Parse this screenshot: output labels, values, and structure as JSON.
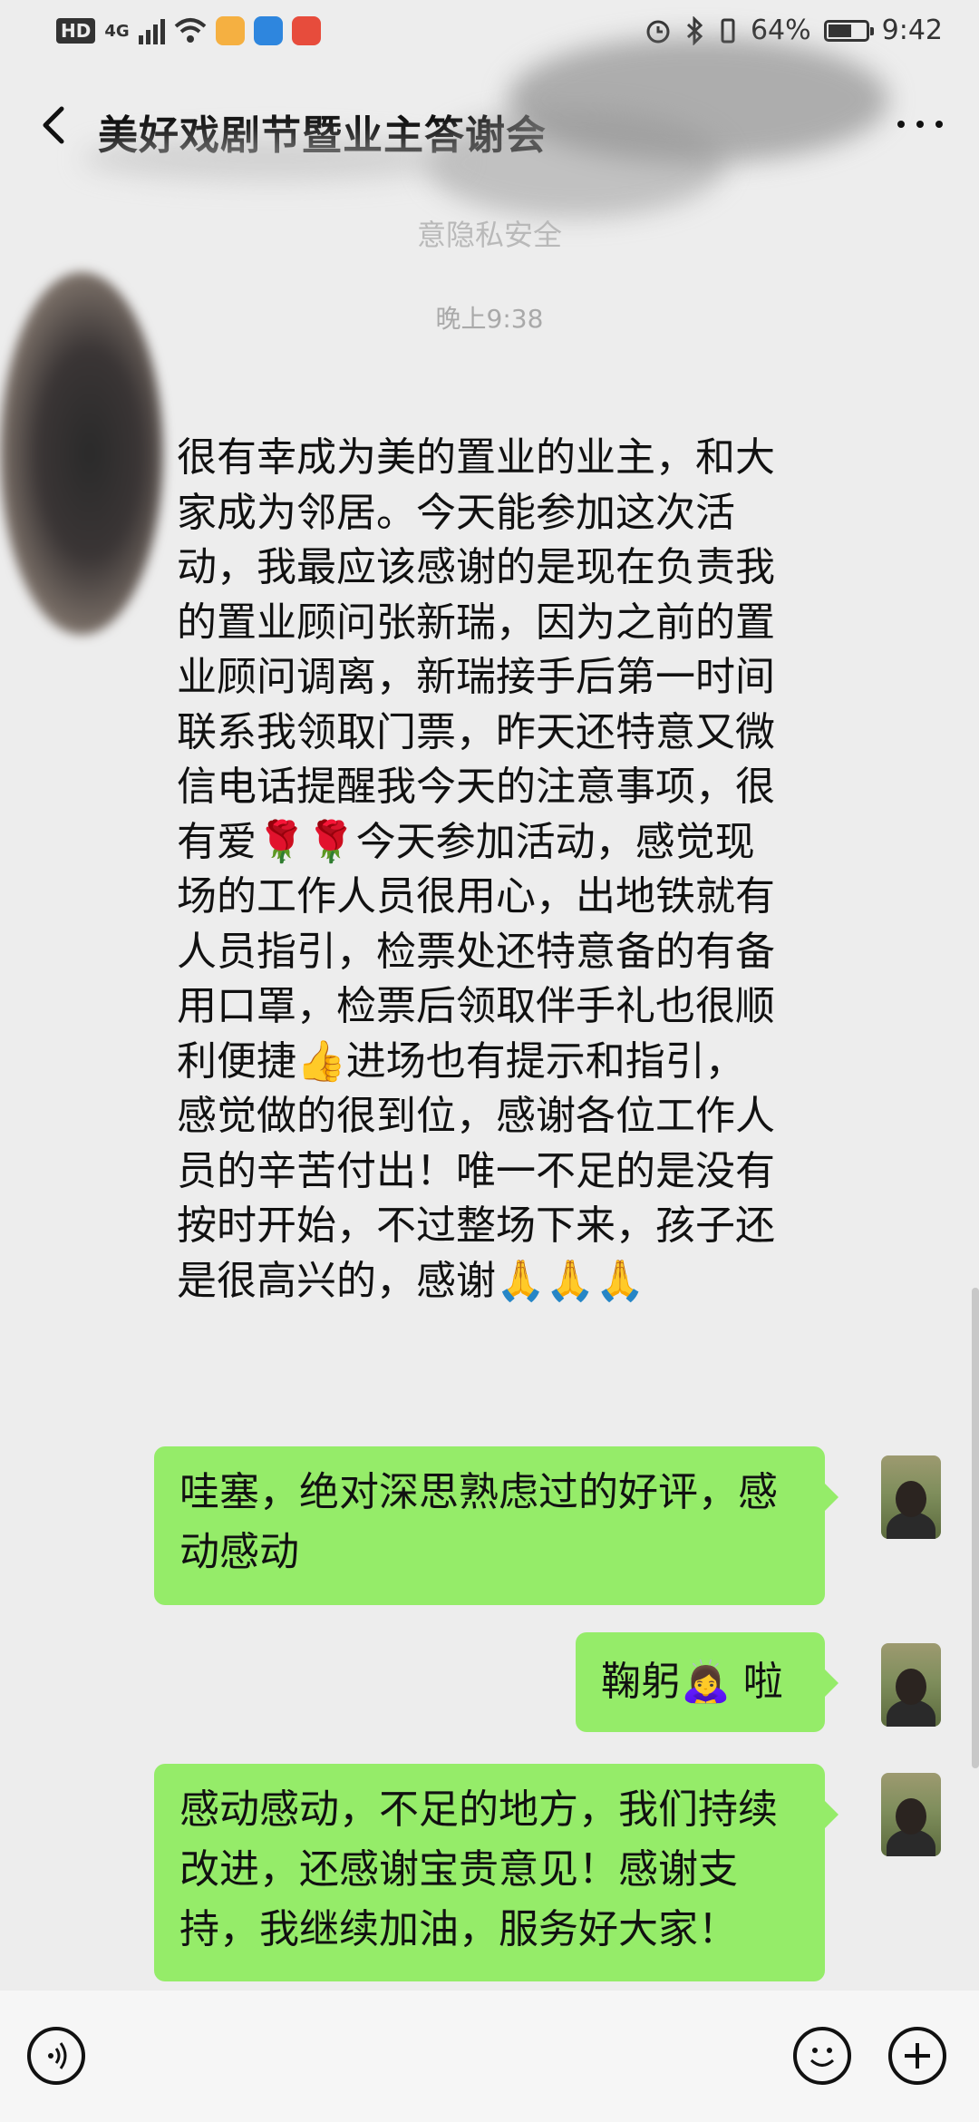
{
  "status_bar": {
    "hd": "HD",
    "network": "4G",
    "battery": "64%",
    "time": "9:42",
    "battery_level": 0.64
  },
  "header": {
    "title": "美好戏剧节暨业主答谢会",
    "back_icon": "chevron-left-icon",
    "more_icon": "more-dots-icon"
  },
  "notice": "意隐私安全",
  "timestamp": "晚上9:38",
  "messages": {
    "received": [
      "很有幸成为美的置业的业主，和大",
      "家成为邻居。今天能参加这次活",
      "动，我最应该感谢的是现在负责我",
      "的置业顾问张新瑞，因为之前的置",
      "业顾问调离，新瑞接手后第一时间",
      "联系我领取门票，昨天还特意又微",
      "信电话提醒我今天的注意事项，很",
      "有爱🌹🌹今天参加活动，感觉现",
      "场的工作人员很用心，出地铁就有",
      "人员指引，检票处还特意备的有备",
      "用口罩，检票后领取伴手礼也很顺",
      "利便捷👍进场也有提示和指引，",
      "感觉做的很到位，感谢各位工作人",
      "员的辛苦付出！唯一不足的是没有",
      "按时开始，不过整场下来，孩子还",
      "是很高兴的，感谢🙏🙏🙏"
    ],
    "sent_1": [
      "哇塞，绝对深思熟虑过的好评，感",
      "动感动"
    ],
    "sent_2": "鞠躬🙇‍♀️ 啦",
    "sent_3": [
      "感动感动，不足的地方，我们持续",
      "改进，还感谢宝贵意见！感谢支",
      "持，我继续加油，服务好大家！"
    ]
  },
  "bottom_bar": {
    "voice_icon": "voice-icon",
    "emoji_icon": "emoji-icon",
    "plus_icon": "plus-icon"
  },
  "colors": {
    "background": "#ededed",
    "sent_bubble": "#95ec69",
    "hd_badge": "#333333",
    "app_icon_1": "#f5b041",
    "app_icon_2": "#2e86de",
    "app_icon_3": "#e74c3c"
  }
}
